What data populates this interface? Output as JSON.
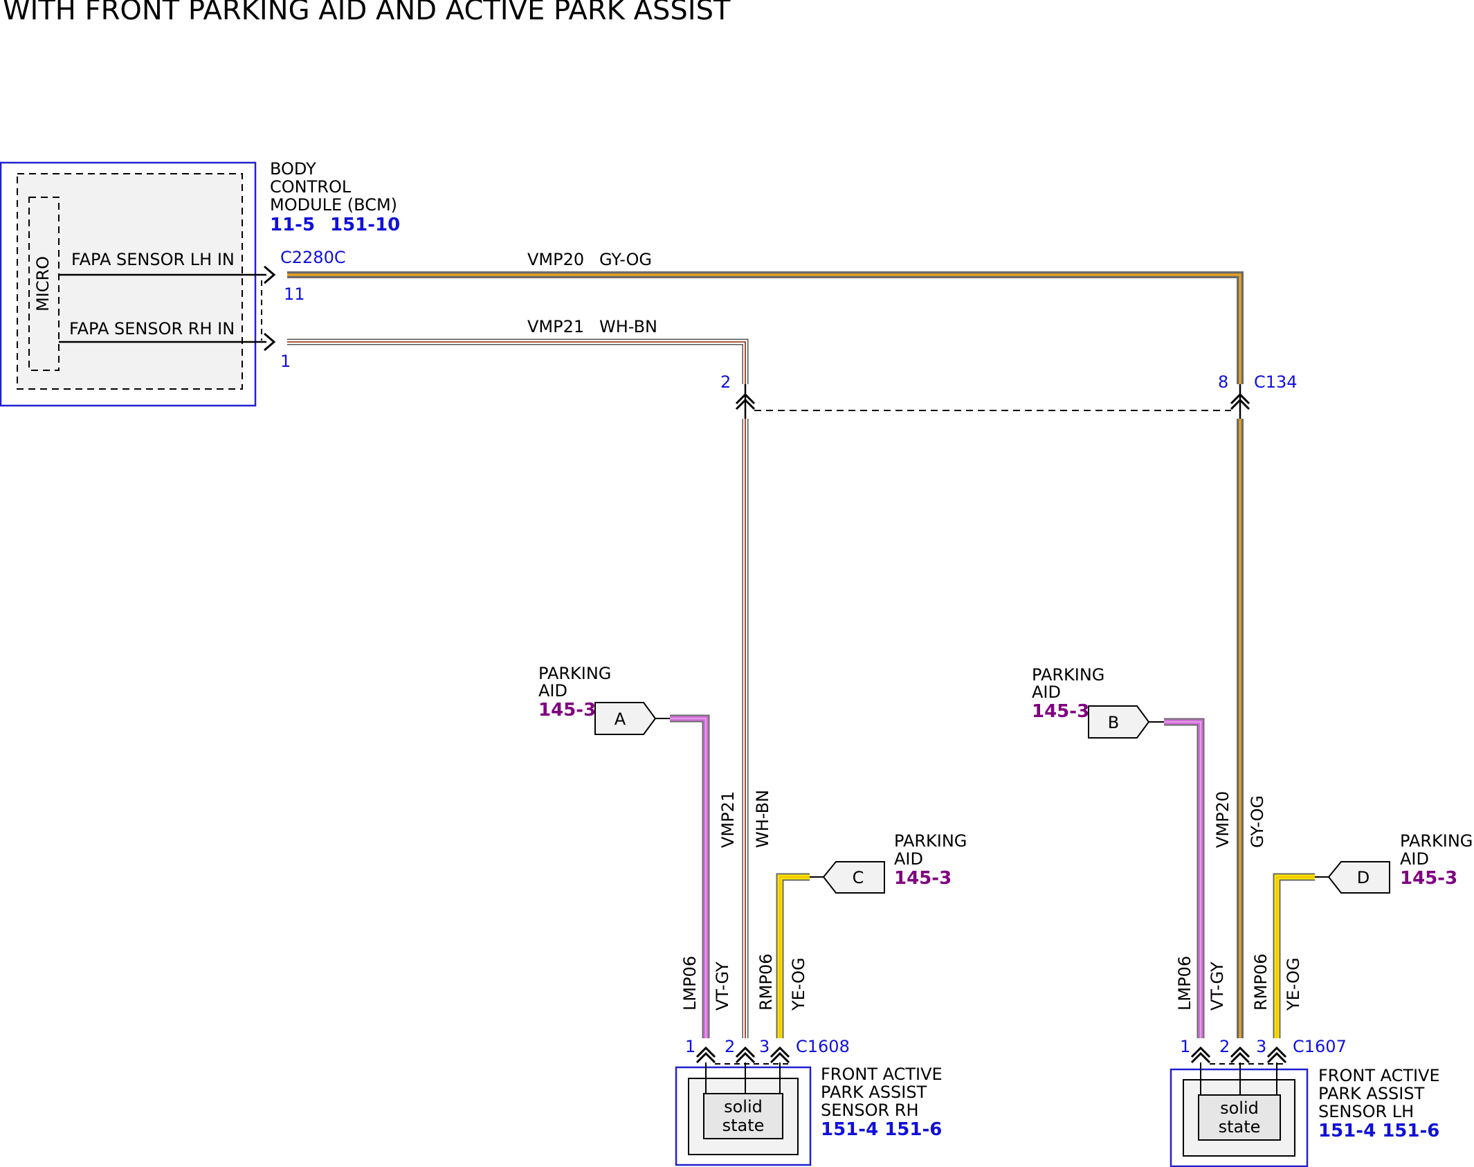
{
  "title": "WITH FRONT PARKING AID AND ACTIVE PARK ASSIST",
  "bcm": {
    "name_lines": [
      "BODY",
      "CONTROL",
      "MODULE (BCM)"
    ],
    "refs": [
      "11-5",
      "151-10"
    ],
    "micro": "MICRO",
    "pin_lh_label": "FAPA SENSOR LH IN",
    "pin_rh_label": "FAPA SENSOR RH IN",
    "connector": "C2280C",
    "pin_lh": "11",
    "pin_rh": "1"
  },
  "wires": {
    "vmp20": {
      "circuit": "VMP20",
      "color": "GY-OG"
    },
    "vmp21": {
      "circuit": "VMP21",
      "color": "WH-BN"
    },
    "lmp06": {
      "circuit": "LMP06",
      "color": "VT-GY"
    },
    "rmp06": {
      "circuit": "RMP06",
      "color": "YE-OG"
    }
  },
  "c134": {
    "name": "C134",
    "pin_rh": "2",
    "pin_lh": "8"
  },
  "connectors": {
    "rh": {
      "name": "C1608",
      "pins": [
        "1",
        "2",
        "3"
      ]
    },
    "lh": {
      "name": "C1607",
      "pins": [
        "1",
        "2",
        "3"
      ]
    }
  },
  "offpage": {
    "a": {
      "letter": "A",
      "label_lines": [
        "PARKING",
        "AID"
      ],
      "ref": "145-3"
    },
    "b": {
      "letter": "B",
      "label_lines": [
        "PARKING",
        "AID"
      ],
      "ref": "145-3"
    },
    "c": {
      "letter": "C",
      "label_lines": [
        "PARKING",
        "AID"
      ],
      "ref": "145-3"
    },
    "d": {
      "letter": "D",
      "label_lines": [
        "PARKING",
        "AID"
      ],
      "ref": "145-3"
    }
  },
  "sensor_rh": {
    "name_lines": [
      "FRONT ACTIVE",
      "PARK ASSIST",
      "SENSOR RH"
    ],
    "refs": "151-4 151-6",
    "inner_lines": [
      "solid",
      "state"
    ]
  },
  "sensor_lh": {
    "name_lines": [
      "FRONT ACTIVE",
      "PARK ASSIST",
      "SENSOR LH"
    ],
    "refs": "151-4 151-6",
    "inner_lines": [
      "solid",
      "state"
    ]
  },
  "colors": {
    "frame": "#2020d0",
    "gray": "#6b6b6b",
    "orange": "#e8a020",
    "white": "#ffffff",
    "brown": "#8b2500",
    "violet": "#d070d8",
    "yellow": "#f5e600",
    "ref_blue": "#1010d8",
    "ref_purple": "#800080"
  }
}
